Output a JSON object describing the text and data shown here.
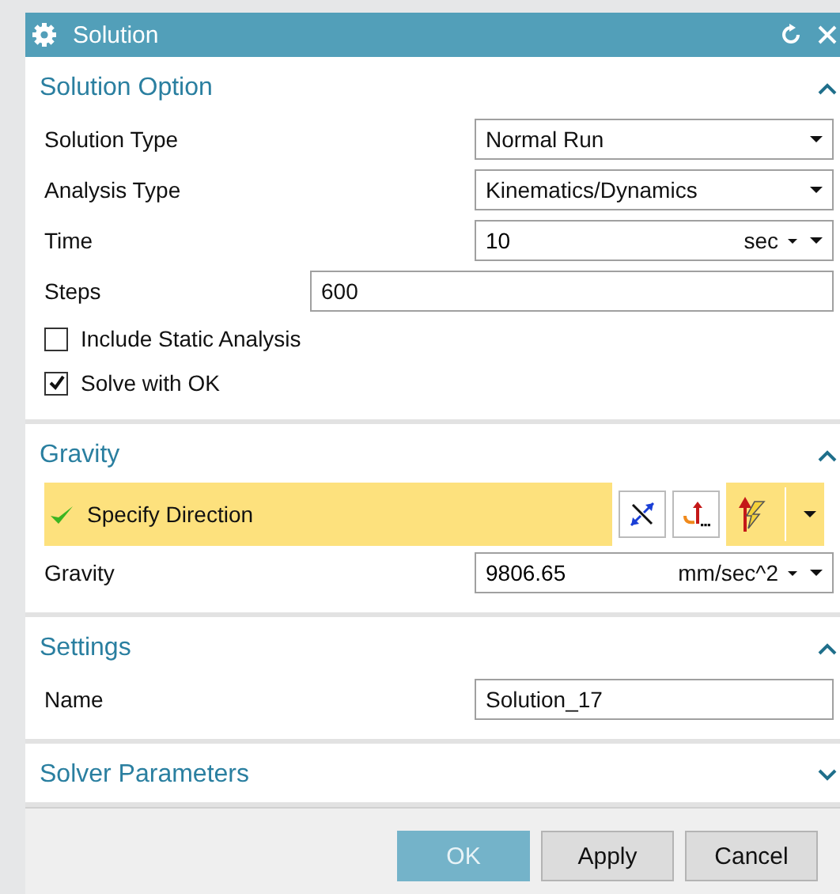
{
  "window": {
    "title": "Solution"
  },
  "sections": [
    {
      "title": "Solution Option",
      "expanded": true,
      "rows": [
        {
          "kind": "dropdown",
          "label": "Solution Type",
          "value": "Normal Run"
        },
        {
          "kind": "dropdown",
          "label": "Analysis Type",
          "value": "Kinematics/Dynamics"
        },
        {
          "kind": "unit",
          "label": "Time",
          "value": "10",
          "unit": "sec"
        },
        {
          "kind": "entry",
          "label": "Steps",
          "value": "600"
        },
        {
          "kind": "checkbox",
          "label": "Include Static Analysis",
          "checked": false
        },
        {
          "kind": "checkbox",
          "label": "Solve with OK",
          "checked": true
        }
      ]
    },
    {
      "title": "Gravity",
      "expanded": true,
      "rows": [
        {
          "kind": "vector",
          "label": "Specify Direction",
          "specified": true
        },
        {
          "kind": "unit",
          "label": "Gravity",
          "value": "9806.65",
          "unit": "mm/sec^2"
        }
      ]
    },
    {
      "title": "Settings",
      "expanded": true,
      "rows": [
        {
          "kind": "field",
          "label": "Name",
          "value": "Solution_17"
        }
      ]
    },
    {
      "title": "Solver Parameters",
      "expanded": false
    }
  ],
  "buttons": [
    {
      "label": "OK",
      "default": true
    },
    {
      "label": "Apply",
      "default": false
    },
    {
      "label": "Cancel",
      "default": false
    }
  ]
}
